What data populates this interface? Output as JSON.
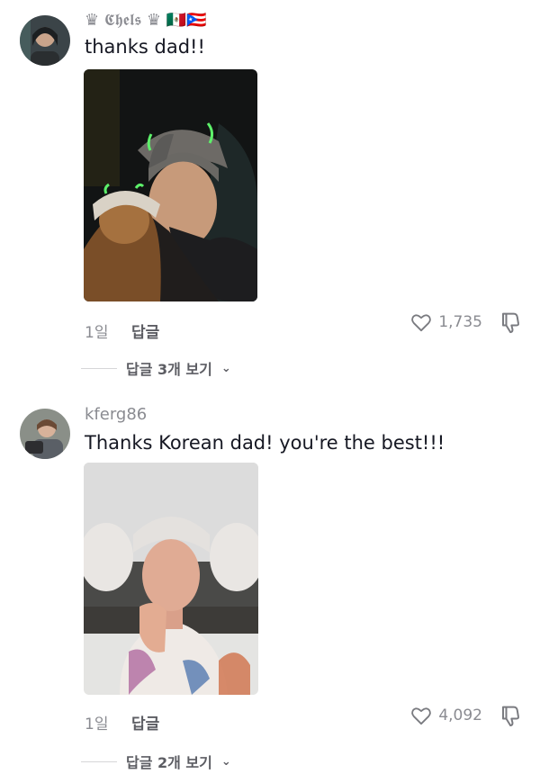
{
  "comments": [
    {
      "username": "♛ 𝕮𝖍𝖊𝖑𝖘 ♛ 🇲🇽🇵🇷",
      "text": "thanks dad!!",
      "age": "1일",
      "reply_label": "답글",
      "likes": "1,735",
      "view_replies": "답글 3개 보기"
    },
    {
      "username": "kferg86",
      "text": "Thanks Korean dad! you're the best!!!",
      "age": "1일",
      "reply_label": "답글",
      "likes": "4,092",
      "view_replies": "답글 2개 보기"
    }
  ],
  "icons": {
    "like": "heart-outline-icon",
    "dislike": "thumbs-down-icon",
    "chevron": "chevron-down-icon"
  },
  "colors": {
    "muted": "#8a8b91",
    "text": "#161823"
  }
}
